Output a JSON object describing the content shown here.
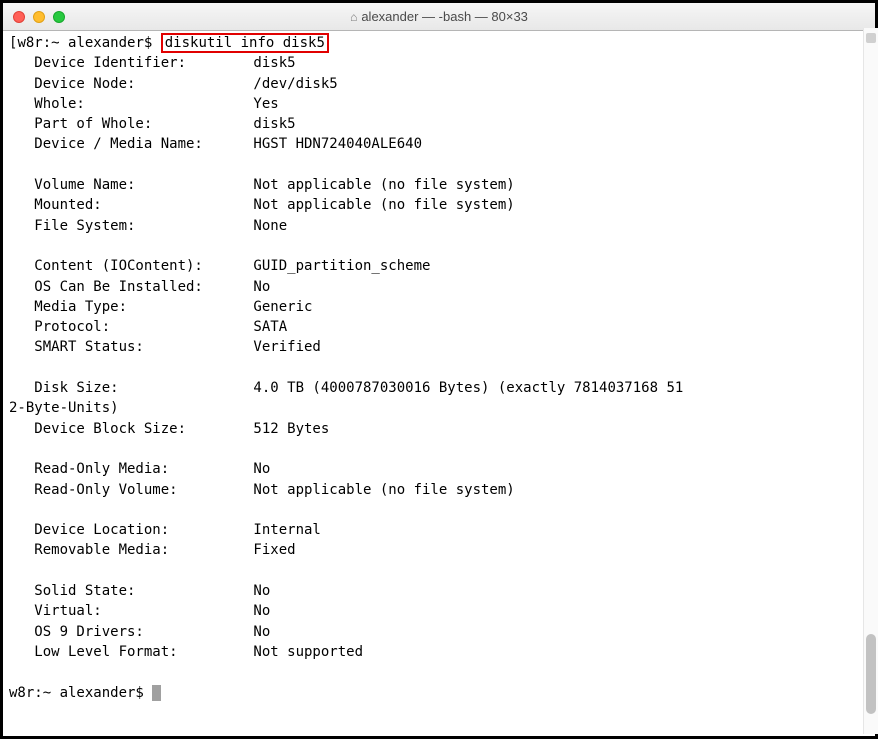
{
  "titlebar": {
    "title": "alexander — -bash — 80×33"
  },
  "prompt": {
    "text": "w8r:~ alexander$ ",
    "command": "diskutil info disk5"
  },
  "output": {
    "rows": [
      {
        "label": "   Device Identifier:        ",
        "value": "disk5"
      },
      {
        "label": "   Device Node:              ",
        "value": "/dev/disk5"
      },
      {
        "label": "   Whole:                    ",
        "value": "Yes"
      },
      {
        "label": "   Part of Whole:            ",
        "value": "disk5"
      },
      {
        "label": "   Device / Media Name:      ",
        "value": "HGST HDN724040ALE640"
      },
      {
        "label": "",
        "value": ""
      },
      {
        "label": "   Volume Name:              ",
        "value": "Not applicable (no file system)"
      },
      {
        "label": "   Mounted:                  ",
        "value": "Not applicable (no file system)"
      },
      {
        "label": "   File System:              ",
        "value": "None"
      },
      {
        "label": "",
        "value": ""
      },
      {
        "label": "   Content (IOContent):      ",
        "value": "GUID_partition_scheme"
      },
      {
        "label": "   OS Can Be Installed:      ",
        "value": "No"
      },
      {
        "label": "   Media Type:               ",
        "value": "Generic"
      },
      {
        "label": "   Protocol:                 ",
        "value": "SATA"
      },
      {
        "label": "   SMART Status:             ",
        "value": "Verified"
      },
      {
        "label": "",
        "value": ""
      },
      {
        "label": "   Disk Size:                ",
        "value": "4.0 TB (4000787030016 Bytes) (exactly 7814037168 51"
      },
      {
        "label": "2-Byte-Units)",
        "value": ""
      },
      {
        "label": "   Device Block Size:        ",
        "value": "512 Bytes"
      },
      {
        "label": "",
        "value": ""
      },
      {
        "label": "   Read-Only Media:          ",
        "value": "No"
      },
      {
        "label": "   Read-Only Volume:         ",
        "value": "Not applicable (no file system)"
      },
      {
        "label": "",
        "value": ""
      },
      {
        "label": "   Device Location:          ",
        "value": "Internal"
      },
      {
        "label": "   Removable Media:          ",
        "value": "Fixed"
      },
      {
        "label": "",
        "value": ""
      },
      {
        "label": "   Solid State:              ",
        "value": "No"
      },
      {
        "label": "   Virtual:                  ",
        "value": "No"
      },
      {
        "label": "   OS 9 Drivers:             ",
        "value": "No"
      },
      {
        "label": "   Low Level Format:         ",
        "value": "Not supported"
      }
    ]
  },
  "prompt2": {
    "text": "w8r:~ alexander$ "
  }
}
